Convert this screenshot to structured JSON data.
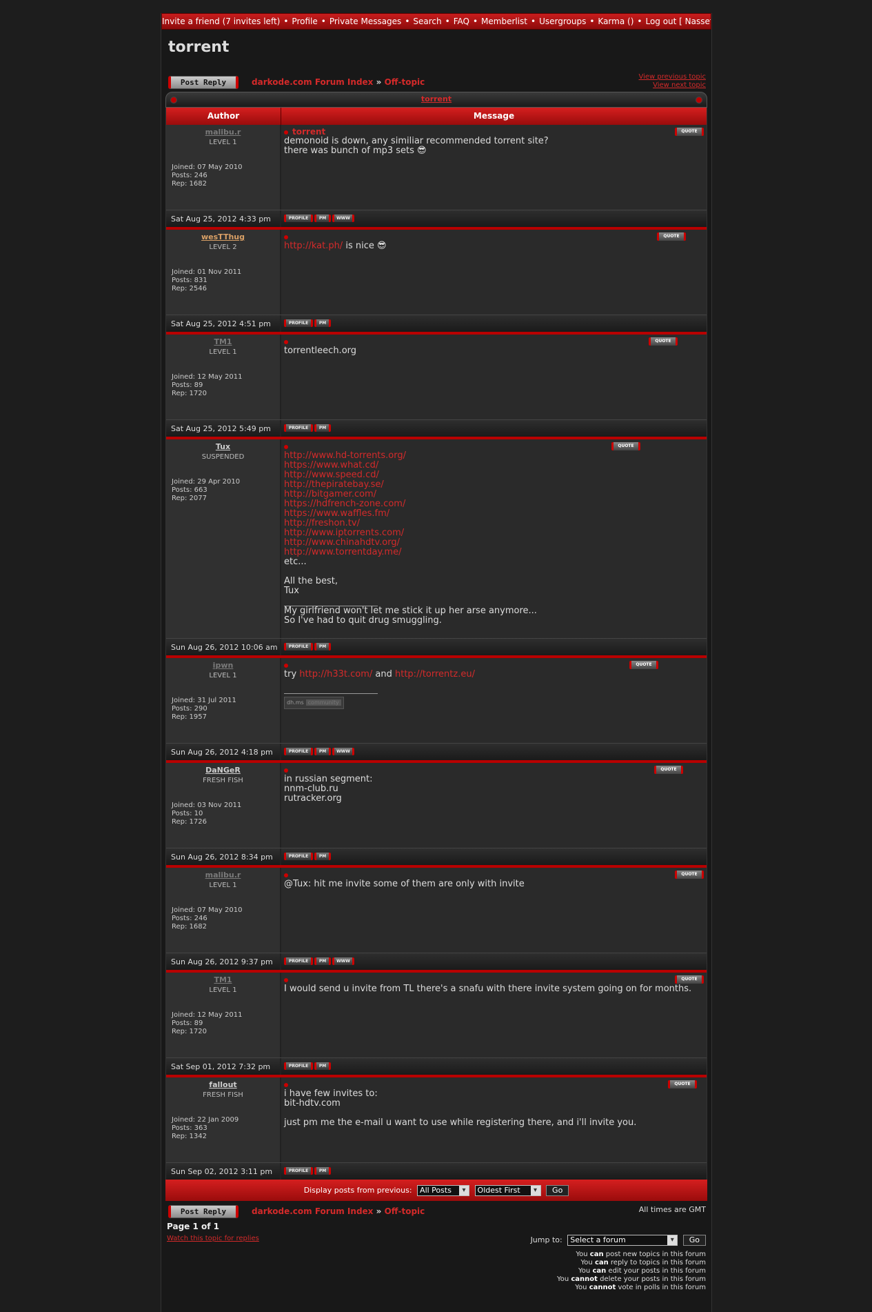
{
  "nav": {
    "items": [
      "Invite a friend (7 invites left)",
      "Profile",
      "Private Messages",
      "Search",
      "FAQ",
      "Memberlist",
      "Usergroups",
      "Karma ()",
      "Log out [ Nassef ]"
    ]
  },
  "topic": {
    "title": "torrent",
    "table_title": "torrent"
  },
  "actions": {
    "post_reply": "Post Reply",
    "view_prev": "View previous topic",
    "view_next": "View next topic",
    "quote": "QUOTE",
    "profile": "PROFILE",
    "pm": "PM",
    "www": "WWW"
  },
  "breadcrumb": {
    "index": "darkode.com Forum Index",
    "arrow": "»",
    "forum": "Off-topic"
  },
  "table": {
    "author_header": "Author",
    "message_header": "Message"
  },
  "posts": [
    {
      "name": "malibu.r",
      "name_color": "#7a7a7a",
      "rank": "LEVEL 1",
      "joined": "Joined: 07 May 2010",
      "posts": "Posts: 246",
      "rep": "Rep: 1682",
      "subject": "torrent",
      "date": "Sat Aug 25, 2012 4:33 pm",
      "lines": [
        "demonoid is down, any similiar recommended torrent site?",
        "there was bunch of mp3 sets 😎"
      ]
    },
    {
      "name": "wesTThug",
      "name_color": "#d9a066",
      "rank": "LEVEL 2",
      "joined": "Joined: 01 Nov 2011",
      "posts": "Posts: 831",
      "rep": "Rep: 2546",
      "subject": "",
      "date": "Sat Aug 25, 2012 4:51 pm",
      "link": "http://kat.ph/",
      "after_link": " is nice 😎"
    },
    {
      "name": "TM1",
      "name_color": "#7a7a7a",
      "rank": "LEVEL 1",
      "joined": "Joined: 12 May 2011",
      "posts": "Posts: 89",
      "rep": "Rep: 1720",
      "subject": "",
      "date": "Sat Aug 25, 2012 5:49 pm",
      "lines": [
        "torrentleech.org"
      ]
    },
    {
      "name": "Tux",
      "name_color": "#cfcfcf",
      "rank": "SUSPENDED",
      "joined": "Joined: 29 Apr 2010",
      "posts": "Posts: 663",
      "rep": "Rep: 2077",
      "subject": "",
      "date": "Sun Aug 26, 2012 10:06 am",
      "links": [
        "http://www.hd-torrents.org/",
        "https://www.what.cd/",
        "http://www.speed.cd/",
        "http://thepiratebay.se/",
        "http://bitgamer.com/",
        "https://hdfrench-zone.com/",
        "https://www.waffles.fm/",
        "http://freshon.tv/",
        "http://www.iptorrents.com/",
        "http://www.chinahdtv.org/",
        "http://www.torrentday.me/"
      ],
      "etc": "etc...",
      "sign1": "All the best,",
      "sign2": "Tux",
      "sig1": "My girlfriend won't let me stick it up her arse anymore...",
      "sig2": "So I've had to quit drug smuggling."
    },
    {
      "name": "ipwn",
      "name_color": "#7a7a7a",
      "rank": "LEVEL 1",
      "joined": "Joined: 31 Jul 2011",
      "posts": "Posts: 290",
      "rep": "Rep: 1957",
      "subject": "",
      "date": "Sun Aug 26, 2012 4:18 pm",
      "pre": "try ",
      "link1": "http://h33t.com/",
      "mid": " and ",
      "link2": "http://torrentz.eu/",
      "badge1": "dh.ms",
      "badge2": "community"
    },
    {
      "name": "DaNGeR",
      "name_color": "#cfcfcf",
      "rank": "FRESH FISH",
      "joined": "Joined: 03 Nov 2011",
      "posts": "Posts: 10",
      "rep": "Rep: 1726",
      "subject": "",
      "date": "Sun Aug 26, 2012 8:34 pm",
      "lines": [
        "in russian segment:",
        "nnm-club.ru",
        "rutracker.org"
      ]
    },
    {
      "name": "malibu.r",
      "name_color": "#7a7a7a",
      "rank": "LEVEL 1",
      "joined": "Joined: 07 May 2010",
      "posts": "Posts: 246",
      "rep": "Rep: 1682",
      "subject": "",
      "date": "Sun Aug 26, 2012 9:37 pm",
      "lines": [
        "@Tux: hit me invite some of them are only with invite"
      ]
    },
    {
      "name": "TM1",
      "name_color": "#7a7a7a",
      "rank": "LEVEL 1",
      "joined": "Joined: 12 May 2011",
      "posts": "Posts: 89",
      "rep": "Rep: 1720",
      "subject": "",
      "date": "Sat Sep 01, 2012 7:32 pm",
      "lines": [
        "I would send u invite from TL there's a snafu with there invite system going on for months."
      ]
    },
    {
      "name": "fallout",
      "name_color": "#cfcfcf",
      "rank": "FRESH FISH",
      "joined": "Joined: 22 Jan 2009",
      "posts": "Posts: 363",
      "rep": "Rep: 1342",
      "subject": "",
      "date": "Sun Sep 02, 2012 3:11 pm",
      "lines": [
        "i have few invites to:",
        "bit-hdtv.com",
        "",
        "just pm me the e-mail u want to use while registering there, and i'll invite you."
      ]
    }
  ],
  "display": {
    "label": "Display posts from previous:",
    "period": "All Posts",
    "order": "Oldest First",
    "go": "Go"
  },
  "footer": {
    "timezone": "All times are GMT",
    "page": "Page 1 of 1",
    "watch": "Watch this topic for replies",
    "jump_label": "Jump to:",
    "jump_value": "Select a forum",
    "go": "Go",
    "perms": [
      [
        "You ",
        "can",
        " post new topics in this forum"
      ],
      [
        "You ",
        "can",
        " reply to topics in this forum"
      ],
      [
        "You ",
        "can",
        " edit your posts in this forum"
      ],
      [
        "You ",
        "cannot",
        " delete your posts in this forum"
      ],
      [
        "You ",
        "cannot",
        " vote in polls in this forum"
      ]
    ]
  }
}
